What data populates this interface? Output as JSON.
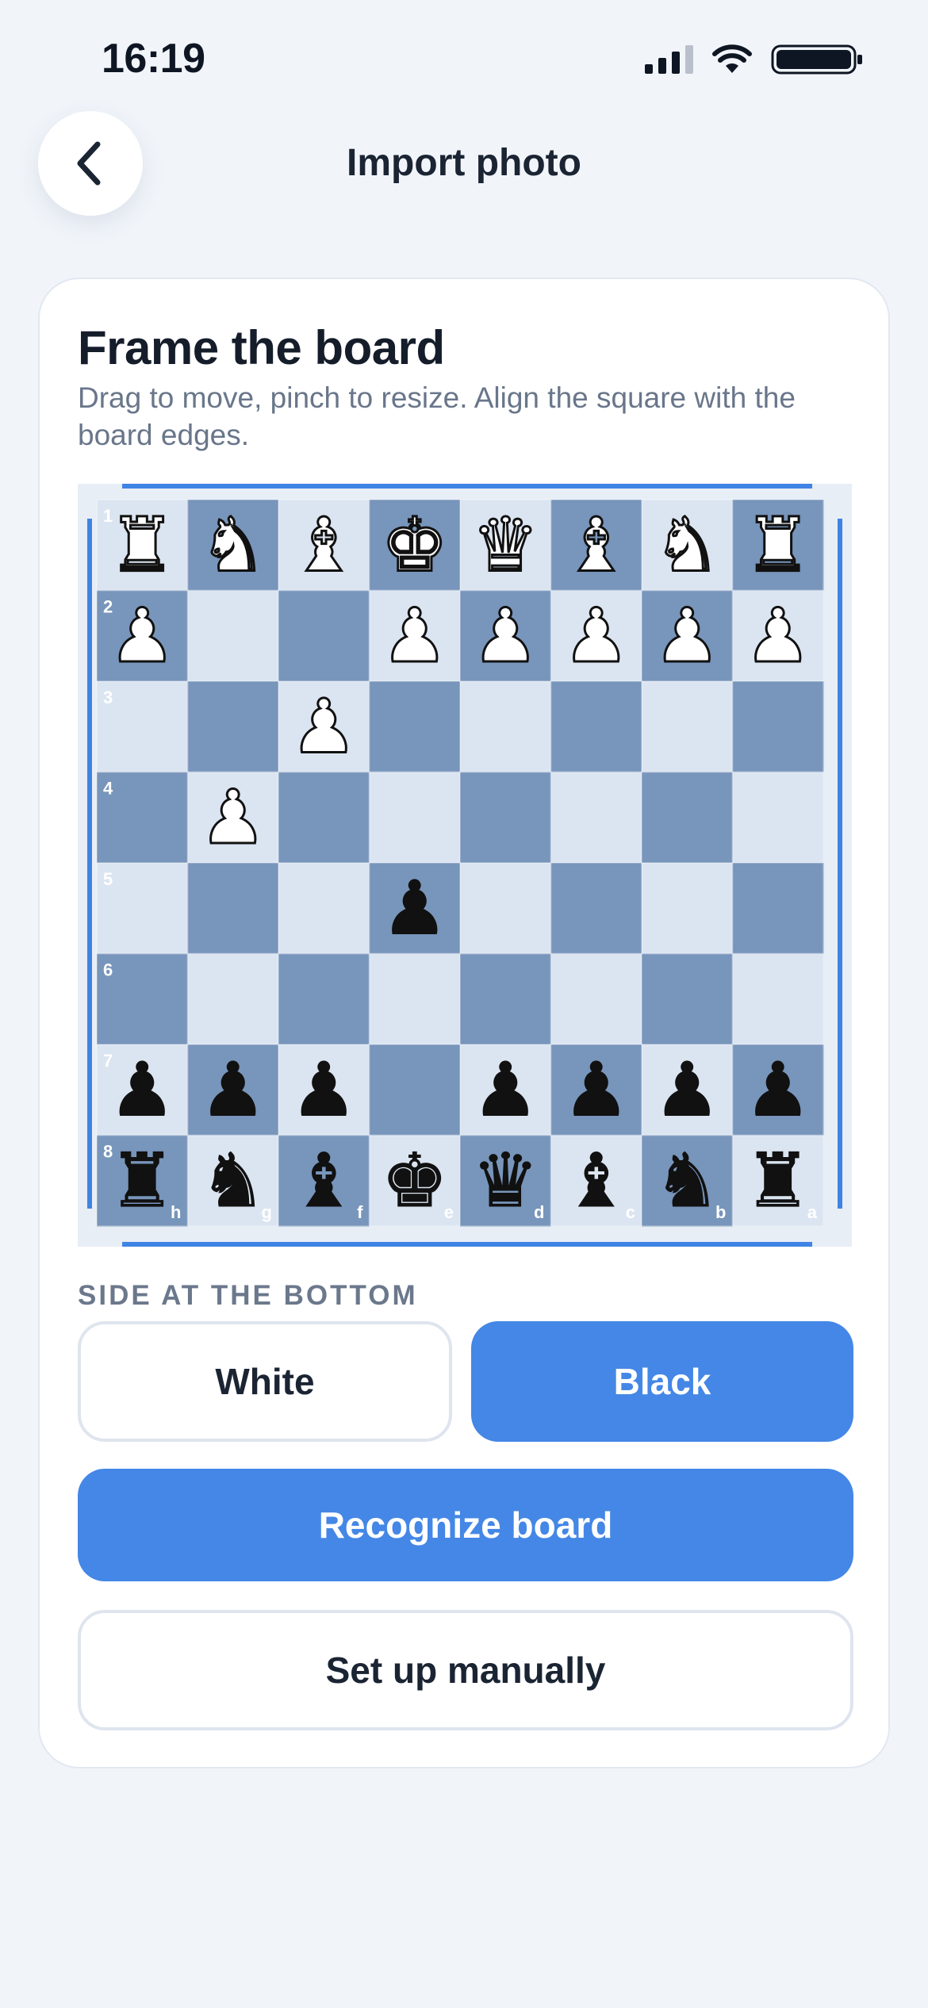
{
  "status_bar": {
    "time": "16:19",
    "icons": [
      "cellular-signal-icon",
      "wifi-icon",
      "battery-icon"
    ]
  },
  "header": {
    "back_icon": "chevron-left-icon",
    "title": "Import photo"
  },
  "card": {
    "title": "Frame the board",
    "subtitle": "Drag to move, pinch to resize. Align the square with the board edges."
  },
  "board": {
    "rank_labels": [
      "1",
      "2",
      "3",
      "4",
      "5",
      "6",
      "7",
      "8"
    ],
    "file_labels": [
      "h",
      "g",
      "f",
      "e",
      "d",
      "c",
      "b",
      "a"
    ],
    "rows": [
      [
        "wR",
        "wN",
        "wB",
        "wK",
        "wQ",
        "wB",
        "wN",
        "wR"
      ],
      [
        "wP",
        "",
        "",
        "wP",
        "wP",
        "wP",
        "wP",
        "wP"
      ],
      [
        "",
        "",
        "wP",
        "",
        "",
        "",
        "",
        ""
      ],
      [
        "",
        "wP",
        "",
        "",
        "",
        "",
        "",
        ""
      ],
      [
        "",
        "",
        "",
        "bP",
        "",
        "",
        "",
        ""
      ],
      [
        "",
        "",
        "",
        "",
        "",
        "",
        "",
        ""
      ],
      [
        "bP",
        "bP",
        "bP",
        "",
        "bP",
        "bP",
        "bP",
        "bP"
      ],
      [
        "bR",
        "bN",
        "bB",
        "bK",
        "bQ",
        "bB",
        "bN",
        "bR"
      ]
    ],
    "colors": {
      "light": "#dbe5f1",
      "dark": "#7895bb",
      "frame": "#3f83e4"
    }
  },
  "side_selector": {
    "label": "SIDE AT THE BOTTOM",
    "options": [
      "White",
      "Black"
    ],
    "selected": "Black"
  },
  "actions": {
    "recognize": "Recognize board",
    "manual": "Set up manually"
  },
  "colors": {
    "accent": "#4487e6",
    "background": "#f1f5fa",
    "text": "#1b2433",
    "muted": "#69768a"
  }
}
